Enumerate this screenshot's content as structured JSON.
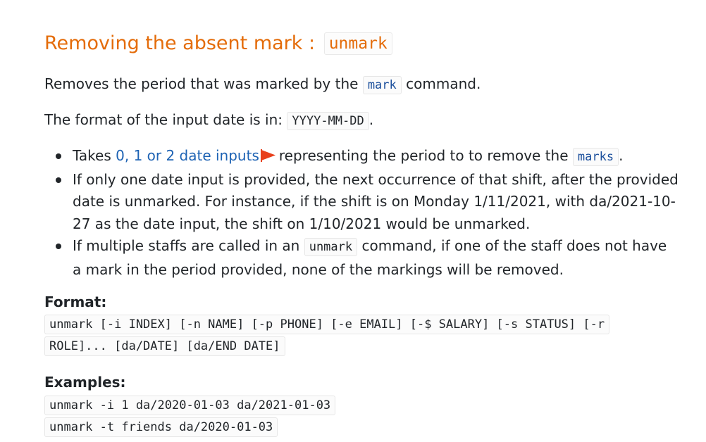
{
  "section": {
    "title_text": "Removing the absent mark : ",
    "title_code": "unmark"
  },
  "description": {
    "before": "Removes the period that was marked by the ",
    "code": "mark",
    "after": " command."
  },
  "date_format": {
    "before": "The format of the input date is in: ",
    "code": "YYYY-MM-DD",
    "after": "."
  },
  "bullets": {
    "item1": {
      "before": "Takes ",
      "link": "0, 1 or 2 date inputs",
      "after": "representing the period to to remove the ",
      "code": "marks",
      "end": "."
    },
    "item2": "If only one date input is provided, the next occurrence of that shift, after the provided date is unmarked. For instance, if the shift is on Monday 1/11/2021, with da/2021-10-27 as the date input, the shift on 1/10/2021 would be unmarked.",
    "item3": {
      "before": "If multiple staffs are called in an ",
      "code": "unmark",
      "after": " command, if one of the staff does not have a mark in the period provided, none of the markings will be removed."
    }
  },
  "format": {
    "label": "Format:",
    "code": "unmark [-i INDEX] [-n NAME] [-p PHONE] [-e EMAIL] [-$ SALARY] [-s STATUS] [-r ROLE]... [da/DATE] [da/END DATE]"
  },
  "examples": {
    "label": "Examples:",
    "items": [
      "unmark -i 1 da/2020-01-03 da/2021-01-03",
      "unmark -t friends da/2020-01-03"
    ]
  },
  "colors": {
    "heading": "#e46c0a",
    "link": "#1e63b4",
    "inline_code_blue": "#1b4f9c",
    "flag": "#e8401c"
  },
  "icons": {
    "footnote_flag": "red-flag-icon"
  }
}
